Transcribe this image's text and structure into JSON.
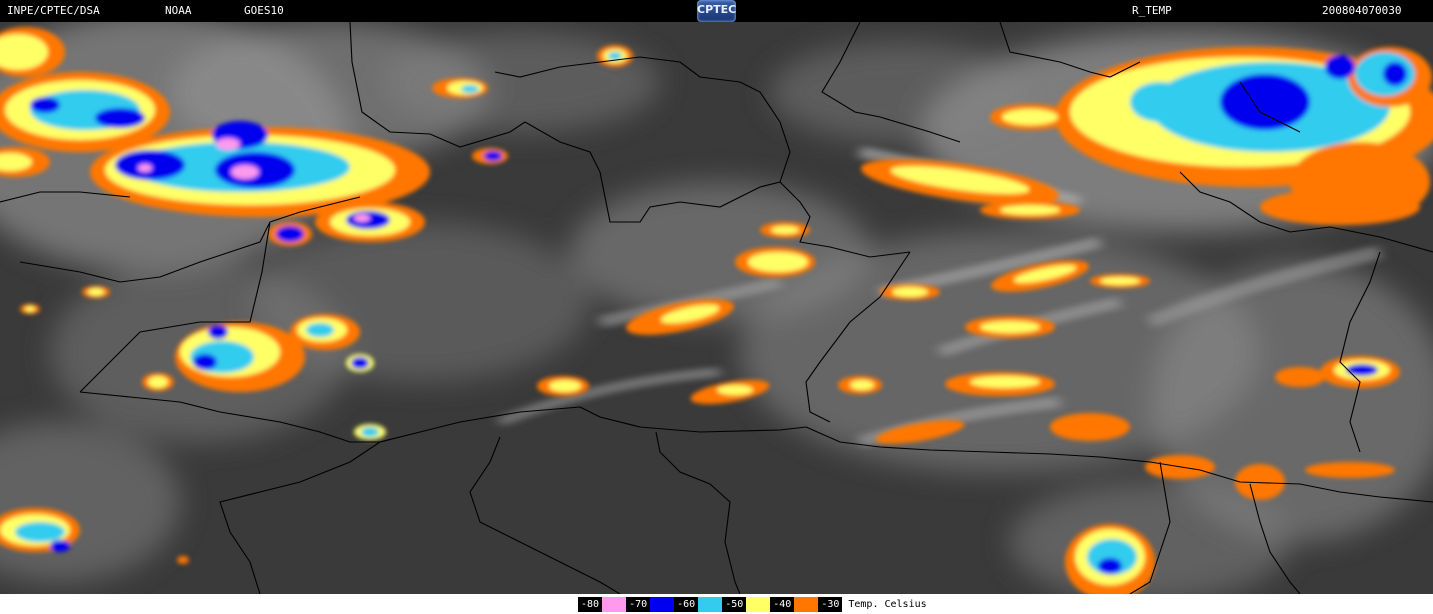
{
  "header": {
    "institute": "INPE/CPTEC/DSA",
    "agency": "NOAA",
    "satellite": "GOES10",
    "logo_text": "CPTEC",
    "product": "R_TEMP",
    "datetime": "200804070030"
  },
  "map": {
    "background_color": "#3a3a3a",
    "border_color": "#000000",
    "layers": [
      "satellite-infrared-clouds",
      "country-borders"
    ]
  },
  "legend": {
    "unit_label": "Temp. Celsius",
    "entries": [
      {
        "label": "-80",
        "color": "#ff99ee"
      },
      {
        "label": "-70",
        "color": "#0000ee"
      },
      {
        "label": "-60",
        "color": "#33ccee"
      },
      {
        "label": "-50",
        "color": "#ffff66"
      },
      {
        "label": "-40",
        "color": "#ff7700"
      },
      {
        "label": "-30",
        "color": "#000000"
      }
    ]
  }
}
